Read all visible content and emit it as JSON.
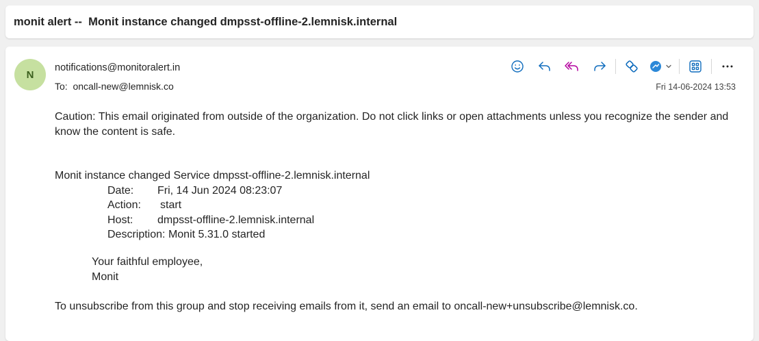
{
  "subject": "monit alert --  Monit instance changed dmpsst-offline-2.lemnisk.internal",
  "sender": {
    "initial": "N",
    "email": "notifications@monitoralert.in",
    "to_label": "To:  ",
    "to_value": "oncall-new@lemnisk.co"
  },
  "date": "Fri 14-06-2024 13:53",
  "toolbar": {
    "icons": [
      "smiley-icon",
      "reply-icon",
      "reply-all-icon",
      "forward-icon",
      "link-icon",
      "app-icon",
      "chevron-down-icon",
      "apps-grid-icon",
      "more-icon"
    ],
    "accent_color": "#0f6cbd",
    "reply_all_color": "#b4009e"
  },
  "body": {
    "caution": "Caution: This email originated from outside of the organization. Do not click links or open attachments unless you recognize the sender and know the content is safe.",
    "headline": "Monit instance changed Service dmpsst-offline-2.lemnisk.internal",
    "fields": {
      "date_label": "Date:",
      "date_value": "Fri, 14 Jun 2024 08:23:07",
      "action_label": "Action:",
      "action_value": "start",
      "host_label": "Host:",
      "host_value": "dmpsst-offline-2.lemnisk.internal",
      "description_label": "Description:",
      "description_value": "Monit 5.31.0 started"
    },
    "signature_line1": "Your faithful employee,",
    "signature_line2": "Monit",
    "unsubscribe": "To unsubscribe from this group and stop receiving emails from it, send an email to oncall-new+unsubscribe@lemnisk.co."
  }
}
